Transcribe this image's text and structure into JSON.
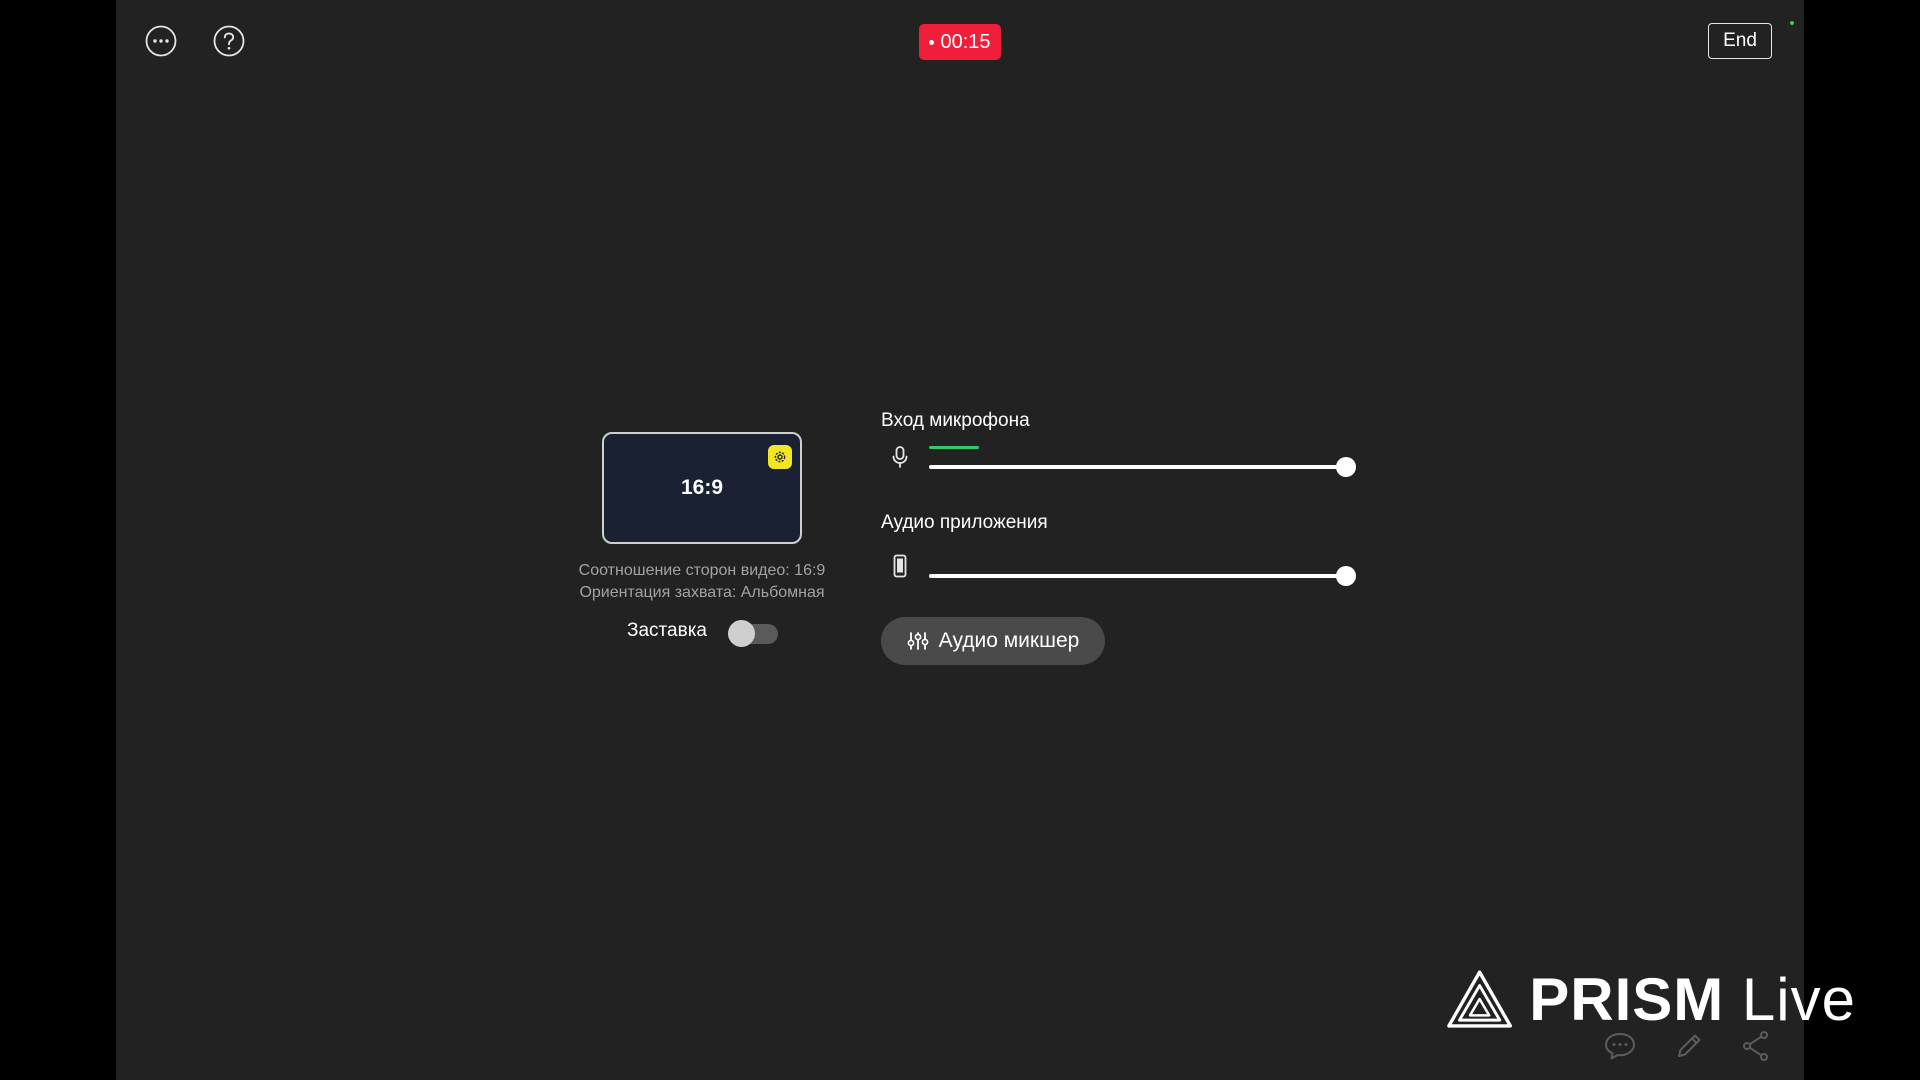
{
  "colors": {
    "background": "#222222",
    "recording": "#ef1f3b",
    "accent_yellow": "#f2e524",
    "meter_green": "#2ecc71",
    "status_dot": "#32d74b"
  },
  "top_bar": {
    "more_icon": "more-horizontal-icon",
    "help_icon": "help-circle-icon",
    "timer": "00:15",
    "end_label": "End"
  },
  "preview": {
    "ratio_label": "16:9",
    "settings_icon": "gear-icon",
    "aspect_info": "Соотношение сторон видео: 16:9",
    "orientation_info": "Ориентация захвата: Альбомная",
    "screensaver_label": "Заставка",
    "screensaver_on": false
  },
  "mixer": {
    "mic": {
      "label": "Вход микрофона",
      "icon": "microphone-icon",
      "level": 0.12,
      "volume": 1.0
    },
    "app_audio": {
      "label": "Аудио приложения",
      "icon": "phone-icon",
      "level": 0.0,
      "volume": 1.0
    },
    "mixer_button_label": "Аудио микшер",
    "mixer_button_icon": "sliders-icon"
  },
  "watermark": {
    "brand_bold": "PRISM",
    "brand_light": "Live"
  },
  "bottom_actions": {
    "chat_icon": "chat-bubble-icon",
    "edit_icon": "pencil-icon",
    "share_icon": "share-icon"
  }
}
